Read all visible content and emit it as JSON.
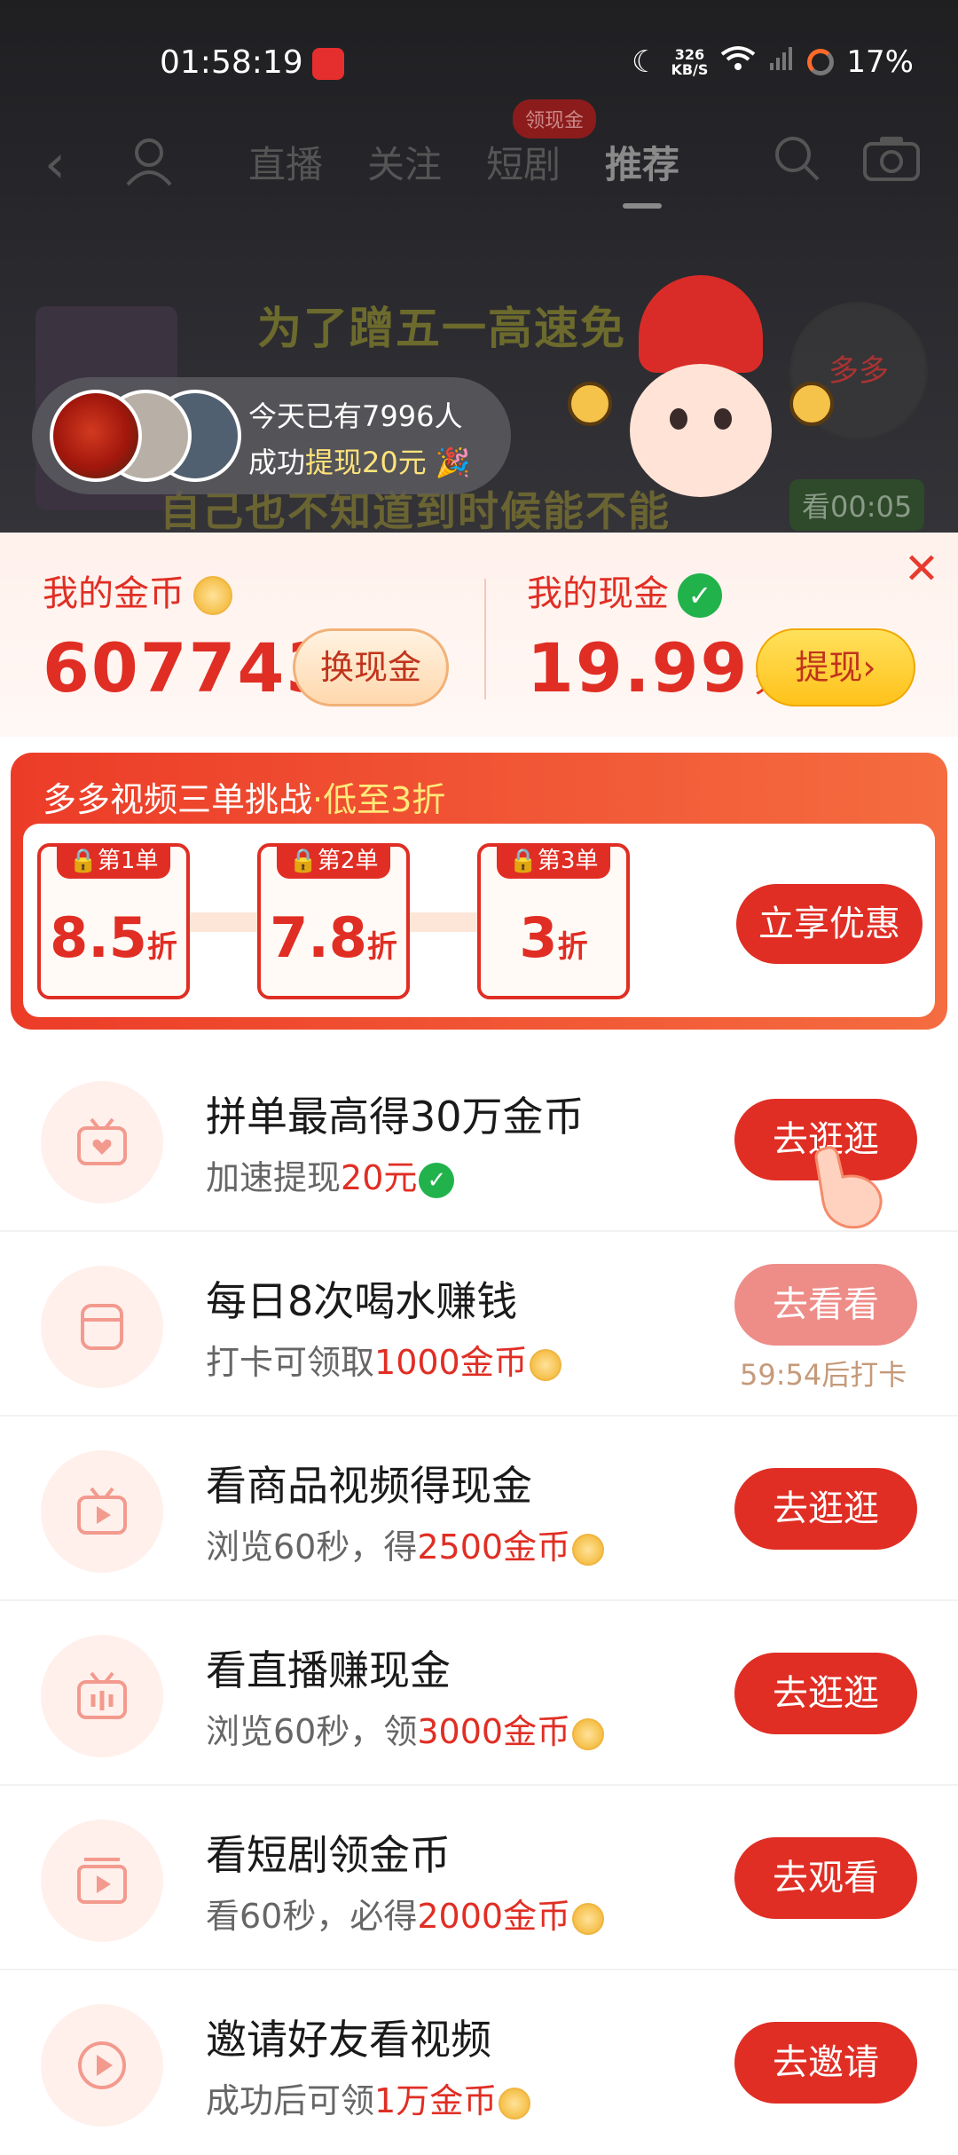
{
  "status_bar": {
    "time": "01:58:19",
    "net_speed_value": "326",
    "net_speed_unit": "KB/S",
    "battery": "17%"
  },
  "nav": {
    "tabs": [
      "直播",
      "关注",
      "短剧",
      "推荐"
    ],
    "badge": "领现金"
  },
  "video": {
    "banner_top": "为了蹭五一高速免",
    "banner_bottom": "自己也不知道到时候能不能",
    "timer": "看00:05",
    "ribbon": "多多"
  },
  "social_proof": {
    "line1": "今天已有7996人",
    "line2_prefix": "成功",
    "line2_highlight": "提现20元",
    "line2_emoji": "🎉"
  },
  "wallet": {
    "coins_label": "我的金币",
    "coins_value": "607743",
    "exchange_button": "换现金",
    "cash_label": "我的现金",
    "cash_value": "19.99",
    "cash_unit": "元",
    "withdraw_button": "提现›",
    "close": "✕"
  },
  "challenge": {
    "title": "多多视频三单挑战",
    "title_highlight": "·低至3折",
    "tickets": [
      {
        "tag": "🔒第1单",
        "value": "8.5",
        "unit": "折"
      },
      {
        "tag": "🔒第2单",
        "value": "7.8",
        "unit": "折"
      },
      {
        "tag": "🔒第3单",
        "value": "3",
        "unit": "折"
      }
    ],
    "button": "立享优惠"
  },
  "tasks": [
    {
      "title": "拼单最高得30万金币",
      "sub_prefix": "加速提现",
      "sub_red": "20元",
      "sub_suffix": "",
      "badge": "check",
      "button": "去逛逛",
      "icon": "tv-heart-icon"
    },
    {
      "title": "每日8次喝水赚钱",
      "sub_prefix": "打卡可领取",
      "sub_red": "1000金币",
      "sub_suffix": "",
      "badge": "coin",
      "button": "去看看",
      "hint": "59:54后打卡",
      "icon": "cup-icon"
    },
    {
      "title": "看商品视频得现金",
      "sub_prefix": "浏览60秒，得",
      "sub_red": "2500金币",
      "sub_suffix": "",
      "badge": "coin",
      "button": "去逛逛",
      "icon": "tv-play-icon"
    },
    {
      "title": "看直播赚现金",
      "sub_prefix": "浏览60秒，领",
      "sub_red": "3000金币",
      "sub_suffix": "",
      "badge": "coin",
      "button": "去逛逛",
      "icon": "tv-live-icon"
    },
    {
      "title": "看短剧领金币",
      "sub_prefix": "看60秒，必得",
      "sub_red": "2000金币",
      "sub_suffix": "",
      "badge": "coin",
      "button": "去观看",
      "icon": "film-icon"
    },
    {
      "title": "邀请好友看视频",
      "sub_prefix": "成功后可领",
      "sub_red": "1万金币",
      "sub_suffix": "",
      "badge": "coin",
      "button": "去邀请",
      "icon": "circle-play-icon"
    }
  ],
  "colors": {
    "brand_red": "#e02e24",
    "accent_gold": "#ffc21a",
    "success_green": "#22b24c"
  }
}
